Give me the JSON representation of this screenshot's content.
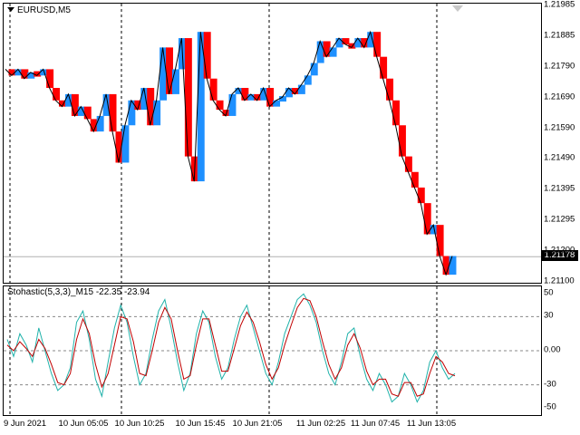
{
  "window": {
    "title": "EURUSD,M5"
  },
  "indicator": {
    "label": "Stohastic(5,3,3)_M15 -22.35 -23.94"
  },
  "price_axis": [
    "1.21985",
    "1.21885",
    "1.21790",
    "1.21690",
    "1.21590",
    "1.21490",
    "1.21395",
    "1.21295",
    "1.21200",
    "1.21100"
  ],
  "current_price": "1.21178",
  "oscillator_axis": [
    "50",
    "30",
    "0.00",
    "-30",
    "-50"
  ],
  "time_axis": [
    "9 Jun 2021",
    "10 Jun 05:05",
    "10 Jun 10:25",
    "10 Jun 15:45",
    "10 Jun 21:05",
    "11 Jun 02:25",
    "11 Jun 07:45",
    "11 Jun 13:05"
  ],
  "colors": {
    "bull": "#1e90ff",
    "bear": "#ff0000",
    "stoch_main": "#20b2aa",
    "stoch_signal": "#c00000",
    "grid": "#000000"
  },
  "chart_data": [
    {
      "type": "line",
      "series": [
        {
          "name": "EURUSD,M5",
          "values": [
            1.2178,
            1.2176,
            1.2178,
            1.2175,
            1.2177,
            1.2176,
            1.2178,
            1.2172,
            1.2168,
            1.2166,
            1.217,
            1.2163,
            1.2166,
            1.2162,
            1.2158,
            1.2163,
            1.217,
            1.2158,
            1.2148,
            1.216,
            1.2168,
            1.2165,
            1.2172,
            1.216,
            1.2168,
            1.2185,
            1.217,
            1.2178,
            1.2188,
            1.215,
            1.2142,
            1.219,
            1.2175,
            1.2168,
            1.2165,
            1.2163,
            1.217,
            1.2172,
            1.2168,
            1.217,
            1.2168,
            1.2172,
            1.2166,
            1.2168,
            1.2169,
            1.2172,
            1.217,
            1.2173,
            1.2176,
            1.218,
            1.2187,
            1.2182,
            1.2185,
            1.2188,
            1.2186,
            1.2185,
            1.2188,
            1.2185,
            1.219,
            1.2182,
            1.2175,
            1.2168,
            1.216,
            1.215,
            1.2145,
            1.214,
            1.2135,
            1.2125,
            1.2128,
            1.2118,
            1.2112,
            1.2118
          ]
        }
      ],
      "ylim": [
        1.211,
        1.21985
      ]
    },
    {
      "type": "line",
      "series": [
        {
          "name": "",
          "values": [
            10,
            -5,
            15,
            5,
            -10,
            20,
            0,
            -20,
            -35,
            -30,
            -15,
            25,
            35,
            10,
            -25,
            -40,
            -10,
            20,
            40,
            25,
            -5,
            -30,
            -20,
            10,
            35,
            45,
            20,
            -10,
            -35,
            -20,
            15,
            35,
            25,
            -5,
            -25,
            -15,
            10,
            30,
            40,
            20,
            0,
            -20,
            -30,
            -10,
            15,
            30,
            45,
            50,
            40,
            25,
            0,
            -20,
            -30,
            -10,
            15,
            20,
            -5,
            -25,
            -35,
            -20,
            -30,
            -45,
            -40,
            -20,
            -30,
            -45,
            -35,
            -10,
            0,
            -15,
            -25,
            -20
          ]
        },
        {
          "name": "",
          "values": [
            5,
            0,
            8,
            2,
            -5,
            10,
            2,
            -12,
            -28,
            -30,
            -20,
            10,
            28,
            15,
            -12,
            -32,
            -20,
            5,
            30,
            28,
            8,
            -20,
            -22,
            0,
            25,
            38,
            28,
            0,
            -25,
            -22,
            5,
            28,
            28,
            5,
            -18,
            -18,
            2,
            22,
            34,
            25,
            8,
            -12,
            -25,
            -15,
            5,
            22,
            38,
            46,
            44,
            30,
            8,
            -12,
            -25,
            -15,
            5,
            15,
            2,
            -18,
            -30,
            -25,
            -25,
            -38,
            -40,
            -28,
            -28,
            -40,
            -38,
            -20,
            -5,
            -10,
            -20,
            -22
          ]
        }
      ],
      "ylim": [
        -55,
        55
      ]
    }
  ]
}
